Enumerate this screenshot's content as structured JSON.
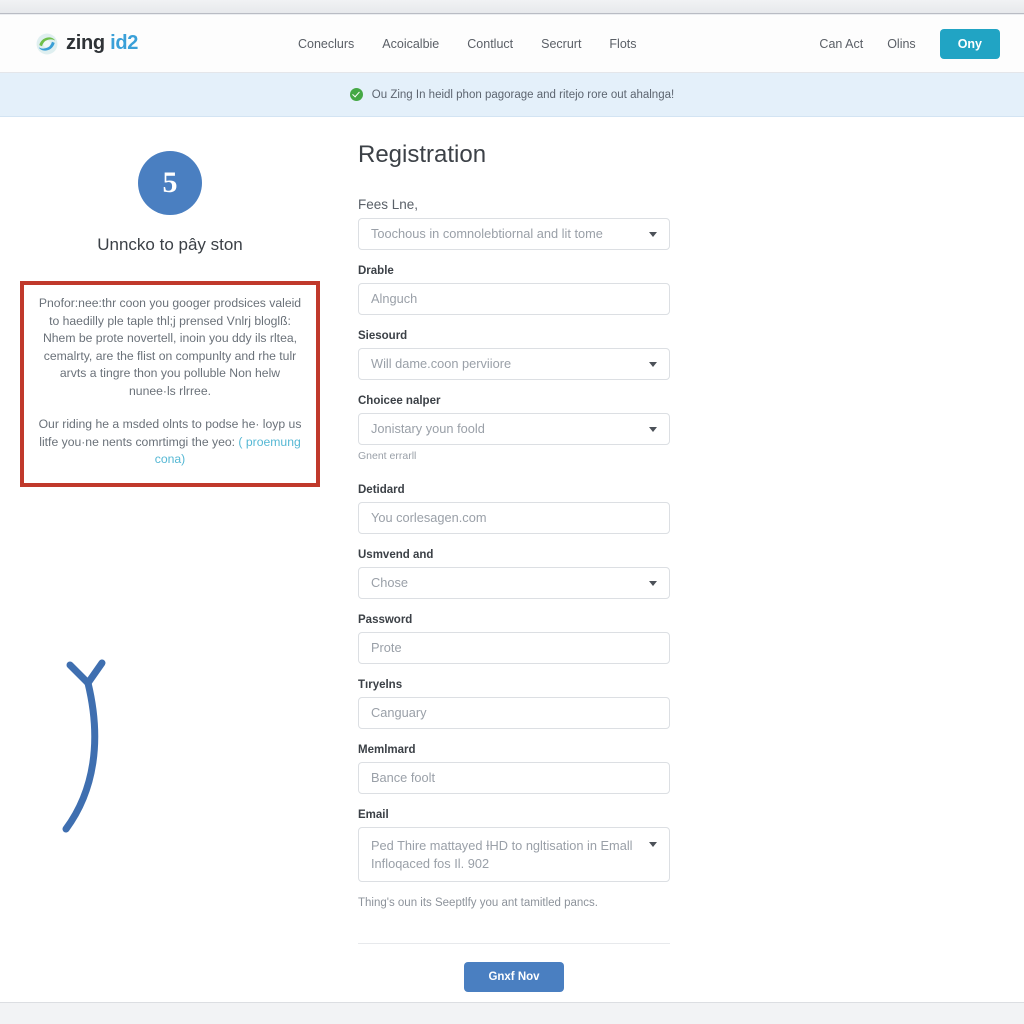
{
  "header": {
    "brand_word1": "zing",
    "brand_word2": "id2",
    "brand_logo_icon": "swirl-logo-icon",
    "nav": [
      {
        "label": "Coneclurs"
      },
      {
        "label": "Acoicalbie"
      },
      {
        "label": "Contluct"
      },
      {
        "label": "Secrurt"
      },
      {
        "label": "Flots"
      }
    ],
    "right_links": [
      {
        "label": "Can Act"
      },
      {
        "label": "Olins"
      }
    ],
    "cta_label": "Ony",
    "cta_color": "#21a4c4"
  },
  "notice": {
    "icon": "check-circle-icon",
    "text": "Ou Zing In heidl phon pagorage and ritejo rore out ahalnga!",
    "background": "#e4f0fa",
    "icon_color": "#45a845"
  },
  "left": {
    "avatar_glyph": "5",
    "avatar_color": "#4a7fc1",
    "title": "Unncko to pây ston",
    "callout": {
      "border_color": "#c0392b",
      "paragraph1": "Pnofor:nee:thr coon you googer prodsices valeid to haedilly ple taple thl;j prensed Vnlrj bloglß: Nhem be prote novertell, inoin you ddy ils rltea, cemalrty, are the flist on compunlty and rhe tulr arvts a tingre thon you polluble Non helw nunee·ls rlrree.",
      "paragraph2_prefix": "Our riding he a msded olnts to podse he· loyp us litfe you·ne nents comrtimgi the yeo:",
      "paragraph2_link": "( proemung cona)",
      "link_color": "#56b8d4"
    },
    "arrow": {
      "icon": "curved-arrow-up-icon",
      "color": "#3f6fb0"
    }
  },
  "form": {
    "title": "Registration",
    "fields": [
      {
        "label": "Fees Lne,",
        "label_style": "soft",
        "type": "select",
        "value": "Toochous in comnolebtiornal and lit tome"
      },
      {
        "label": "Drable",
        "label_style": "bold",
        "type": "text",
        "value": "Alnguch"
      },
      {
        "label": "Siesourd",
        "label_style": "bold",
        "type": "select",
        "value": "Will dame.coon perviiore"
      },
      {
        "label": "Choicee nalper",
        "label_style": "bold",
        "type": "select",
        "value": "Jonistary youn foold",
        "helper": "Gnent errarll"
      },
      {
        "label": "Detidard",
        "label_style": "bold",
        "type": "text",
        "value": "You corlesagen.com"
      },
      {
        "label": "Usmvend and",
        "label_style": "bold",
        "type": "select",
        "value": "Chose"
      },
      {
        "label": "Password",
        "label_style": "bold",
        "type": "text",
        "value": "Prote"
      },
      {
        "label": "Tıryelns",
        "label_style": "bold",
        "type": "text",
        "value": "Canguary"
      },
      {
        "label": "Memlmard",
        "label_style": "bold",
        "type": "text",
        "value": "Bance foolt"
      },
      {
        "label": "Email",
        "label_style": "bold",
        "type": "select-tall",
        "value": "Ped Thire mattayed ƗHD to ngltisation in Emall Infloqaced fos Il. 902"
      }
    ],
    "note": "Thing's oun its Seeptlfy you ant tamitled pancs.",
    "submit_label": "Gnxf Nov",
    "submit_color": "#4a7fc1"
  }
}
